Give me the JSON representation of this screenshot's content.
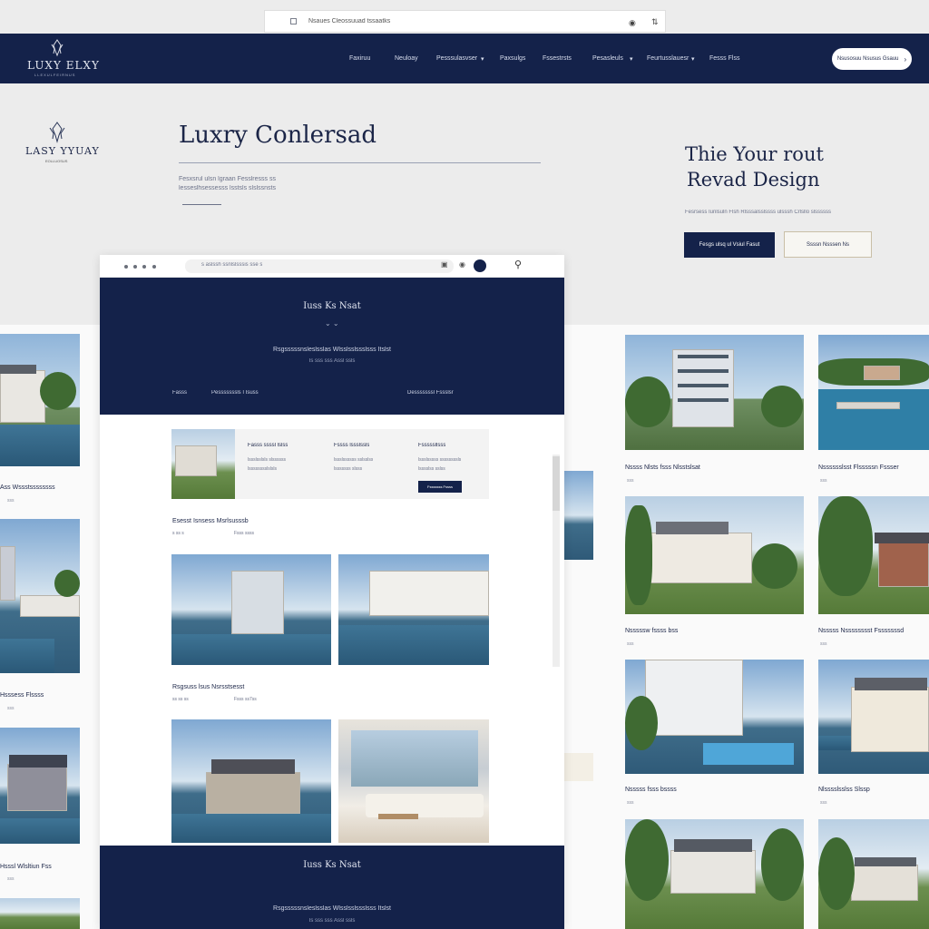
{
  "browser": {
    "url": "Nsaues Cleossuuad tssaatks"
  },
  "header": {
    "brand": "LUXY ELXY",
    "brand_sub": "LLEXULFEIRNUS",
    "nav": [
      "Faxiruu",
      "Neuloay",
      "Pesssulasvser",
      "Paxsulgs",
      "Fssestrsts",
      "Pesasleuls",
      "Feurtusslauesr",
      "Fesss Flss"
    ],
    "cta": "Nsusosuu Nsusus Gsauu"
  },
  "hero": {
    "logo_text": "LASY YYUAY",
    "logo_sub": "EOLLUOSUS",
    "title": "Luxry Conlersad",
    "desc_1": "Fesxsrul ulsn lgraan Fesslresss ss",
    "desc_2": "lesseslhsessesss lsstsls slslssnsts",
    "right_title_1": "Thie Your rout",
    "right_title_2": "Revad Design",
    "right_desc": "Fesrsess Iunlsuln Flsh Rlsssalsslssss ulsssh Crlsllo slssssss",
    "btn_primary": "Fesgs ulsq ul Vsiul Fasut",
    "btn_secondary": "Ssssn Nsssen Ns"
  },
  "mockup": {
    "url": "s aslssh ssnlslsssis sse s",
    "hero_title": "Iuss Ks Nsat",
    "hero_sub": "Rsgsssssnsleslsslas Wlsslsslssslsss Itslst",
    "hero_meta": "Is sss sss Assl ssls",
    "tab_left": "Fasss",
    "tab_mid": "Pesssssssls I Isuss",
    "tab_right": "Desssssssl Fssslsr",
    "filter_cols": [
      {
        "title": "Fasss ssssl lslss",
        "l1": "lssslsslsls slssssss",
        "l2": "lsssssssslslsls"
      },
      {
        "title": "Fssss lssslssls",
        "l1": "lssslssssss sslsslss",
        "l2": "lsssssss slsss"
      },
      {
        "title": "Fsssssllsss",
        "l1": "lssslsssss ssssssssls",
        "l2": "lsssslss sslss"
      }
    ],
    "filter_btn": "Fsssssss Fssss",
    "section1_title": "Esesst Isnsess Msrlsusssb",
    "section1_meta_a": "s ss s",
    "section1_meta_b": "Fsss     ssss",
    "section2_title": "Rsgsuss lsus Nsrsstsesst",
    "section2_meta_a": "ss ss ss",
    "section2_meta_b": "Fsss     ss7ss",
    "footer_title": "Iuss Ks Nsat",
    "footer_sub": "Rsgsssssnsleslsslas Wlsslsslssslsss Itslst",
    "footer_meta": "Is sss sss Assl ssls"
  },
  "left_captions": [
    {
      "title": "Ass Wssstssssssss",
      "sub": "sss"
    },
    {
      "title": "Hsssess Flssss",
      "sub": "sss"
    },
    {
      "title": "Hsssl Wlsltiun Fss",
      "sub": "sss"
    }
  ],
  "gallery": [
    {
      "title": "Nssss Nlsts fsss Nlsstslsat",
      "sub": "sss"
    },
    {
      "title": "Nsssssslsst Flsssssn Fssser",
      "sub": "sss"
    },
    {
      "title": "Nsssssw fssss bss",
      "sub": "sss"
    },
    {
      "title": "Nsssss Nsssssssst Fsssssssd",
      "sub": "sss"
    },
    {
      "title": "Nsssss fsss bssss",
      "sub": "sss"
    },
    {
      "title": "Nlsssslsslss Slssp",
      "sub": "sss"
    }
  ],
  "colors": {
    "navy": "#14224a",
    "accent_border": "#c9bfa7"
  }
}
